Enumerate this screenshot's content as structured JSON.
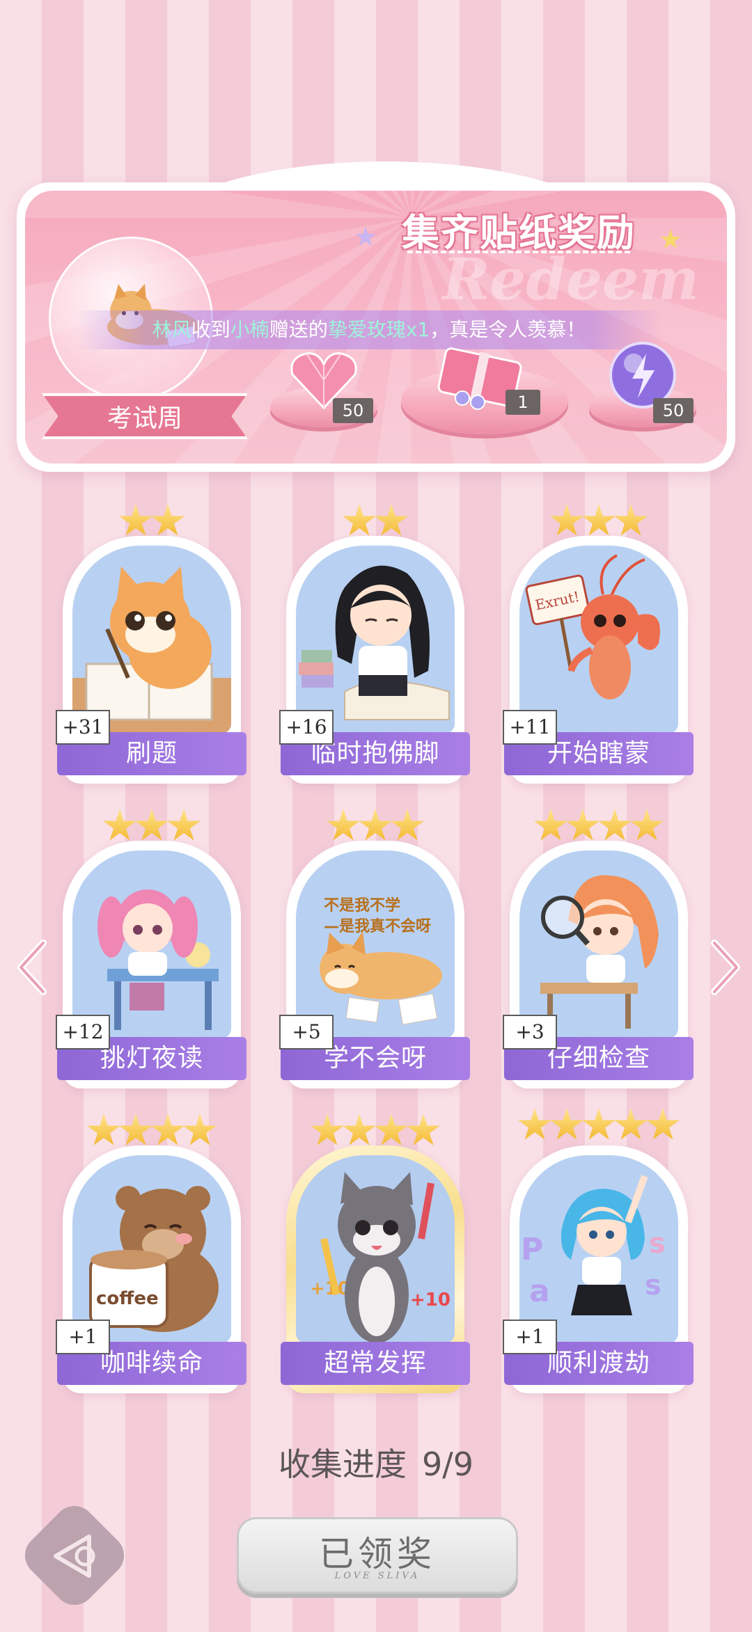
{
  "banner": {
    "title": "集齐贴纸奖励",
    "watermark": "Redeem",
    "theme_label": "考试周",
    "ticker": {
      "sender": "林风",
      "verb1": "收到",
      "receiver": "小楠",
      "verb2": "赠送的",
      "gift": "挚爱玫瑰x1",
      "suffix": "，真是令人羡慕！"
    },
    "rewards": [
      {
        "icon": "pink-heart-gem-icon",
        "count": "50"
      },
      {
        "icon": "gift-box-icon",
        "count": "1"
      },
      {
        "icon": "purple-energy-orb-icon",
        "count": "50"
      }
    ]
  },
  "cards": [
    {
      "name": "刷题",
      "count": "+31",
      "stars": 2,
      "art": "orange-cat-writing"
    },
    {
      "name": "临时抱佛脚",
      "count": "+16",
      "stars": 2,
      "art": "girl-sleeping-on-books"
    },
    {
      "name": "开始瞎蒙",
      "count": "+11",
      "stars": 3,
      "art": "lobster-with-sign",
      "sign_text": "Exrut!"
    },
    {
      "name": "挑灯夜读",
      "count": "+12",
      "stars": 3,
      "art": "pink-hair-girl-at-desk"
    },
    {
      "name": "学不会呀",
      "count": "+5",
      "stars": 3,
      "art": "shiba-lying-down",
      "caption_line1": "不是我不学",
      "caption_line2": "—是我真不会呀"
    },
    {
      "name": "仔细检查",
      "count": "+3",
      "stars": 4,
      "art": "girl-with-magnifier"
    },
    {
      "name": "咖啡续命",
      "count": "+1",
      "stars": 4,
      "art": "bear-with-coffee",
      "cup_text": "coffee"
    },
    {
      "name": "超常发挥",
      "count": "",
      "stars": 4,
      "art": "cat-with-pencils",
      "gold": true,
      "bonus": "+10"
    },
    {
      "name": "顺利渡劫",
      "count": "+1",
      "stars": 5,
      "art": "blue-hair-girl-pass",
      "letters": [
        "P",
        "a",
        "s",
        "s"
      ]
    }
  ],
  "progress": {
    "label": "收集进度",
    "value": "9/9"
  },
  "claim_button": {
    "label": "已领奖",
    "sub": "LOVE SLIVA"
  }
}
